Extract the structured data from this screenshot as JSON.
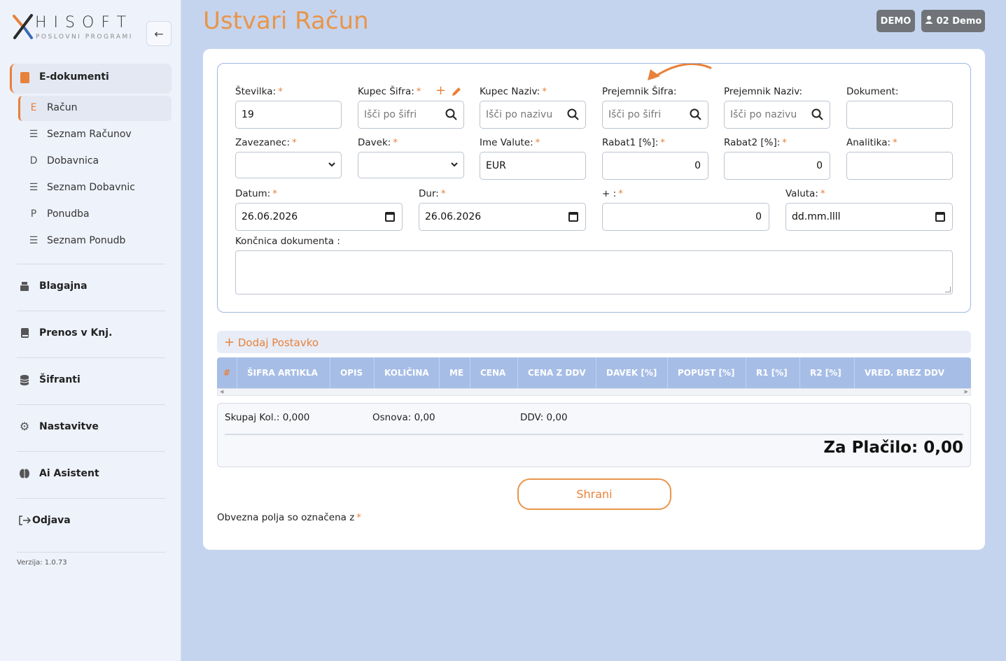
{
  "brand": {
    "word": "HISOFT",
    "subtitle": "POSLOVNI PROGRAMI"
  },
  "sidebar": {
    "group_label": "E-dokumenti",
    "sub_items": [
      {
        "icon_char": "E",
        "label": "Račun"
      },
      {
        "icon_char": "☰",
        "label": "Seznam Računov"
      },
      {
        "icon_char": "D",
        "label": "Dobavnica"
      },
      {
        "icon_char": "☰",
        "label": "Seznam Dobavnic"
      },
      {
        "icon_char": "P",
        "label": "Ponudba"
      },
      {
        "icon_char": "☰",
        "label": "Seznam Ponudb"
      }
    ],
    "main_items": [
      {
        "icon": "cash-register-icon",
        "label": "Blagajna"
      },
      {
        "icon": "book-icon",
        "label": "Prenos v Knj."
      },
      {
        "icon": "database-icon",
        "label": "Šifranti"
      },
      {
        "icon": "gear-icon",
        "label": "Nastavitve"
      },
      {
        "icon": "brain-icon",
        "label": "Ai Asistent"
      },
      {
        "icon": "logout-icon",
        "label": "Odjava"
      }
    ],
    "version": "Verzija: 1.0.73"
  },
  "header": {
    "title": "Ustvari Račun",
    "badge": "DEMO",
    "user": "02 Demo"
  },
  "form": {
    "stevilka": {
      "label": "Številka:",
      "value": "19"
    },
    "kupec_sifra": {
      "label": "Kupec Šifra:",
      "placeholder": "Išči po šifri"
    },
    "kupec_naziv": {
      "label": "Kupec Naziv:",
      "placeholder": "Išči po nazivu"
    },
    "prejemnik_sifra": {
      "label": "Prejemnik Šifra:",
      "placeholder": "Išči po šifri"
    },
    "prejemnik_naziv": {
      "label": "Prejemnik Naziv:",
      "placeholder": "Išči po nazivu"
    },
    "dokument": {
      "label": "Dokument:",
      "value": ""
    },
    "zavezanec": {
      "label": "Zavezanec:",
      "value": ""
    },
    "davek": {
      "label": "Davek:",
      "value": ""
    },
    "ime_valute": {
      "label": "Ime Valute:",
      "value": "EUR"
    },
    "rabat1": {
      "label": "Rabat1 [%]:",
      "value": "0"
    },
    "rabat2": {
      "label": "Rabat2 [%]:",
      "value": "0"
    },
    "analitika": {
      "label": "Analitika:",
      "value": ""
    },
    "datum": {
      "label": "Datum:",
      "value": "26.06.2026"
    },
    "dur": {
      "label": "Dur:",
      "value": "26.06.2026"
    },
    "plus": {
      "label": "+ :",
      "value": "0"
    },
    "valuta": {
      "label": "Valuta:",
      "value": "dd.mm.llll"
    },
    "koncnica": {
      "label": "Končnica dokumenta :"
    },
    "required_mark": "*"
  },
  "items": {
    "add_label": "Dodaj Postavko",
    "columns": [
      "#",
      "ŠIFRA ARTIKLA",
      "OPIS",
      "KOLIČINA",
      "ME",
      "CENA",
      "CENA Z DDV",
      "DAVEK [%]",
      "POPUST [%]",
      "R1 [%]",
      "R2 [%]",
      "VRED. BREZ DDV"
    ]
  },
  "summary": {
    "skupaj": "Skupaj Kol.: 0,000",
    "osnova": "Osnova: 0,00",
    "ddv": "DDV: 0,00",
    "total": "Za Plačilo: 0,00"
  },
  "actions": {
    "save": "Shrani",
    "footnote": "Obvezna polja so označena z"
  },
  "colors": {
    "accent": "#e8813a",
    "background": "#c5d4ee",
    "table_header": "#a6bde6"
  }
}
